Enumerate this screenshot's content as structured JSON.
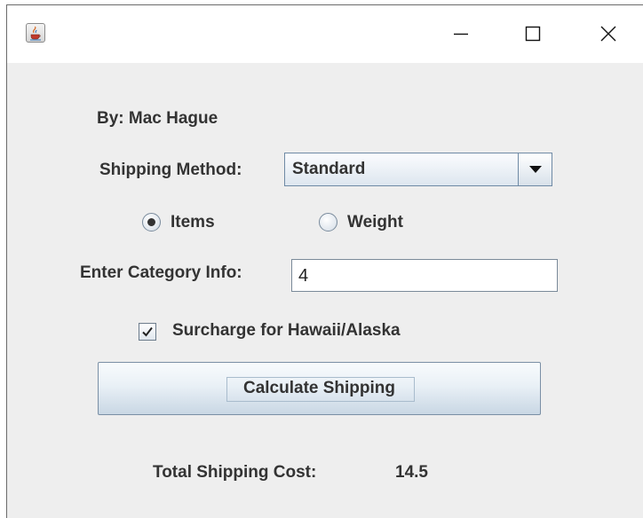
{
  "window": {
    "icon": "java-cup-icon",
    "controls": {
      "minimize_icon": "minimize-icon",
      "maximize_icon": "maximize-icon",
      "close_icon": "close-icon"
    }
  },
  "author_label": "By: Mac Hague",
  "shipping_method": {
    "label": "Shipping Method:",
    "selected": "Standard",
    "arrow_icon": "chevron-down-icon"
  },
  "category_type": {
    "options": [
      {
        "label": "Items",
        "selected": true
      },
      {
        "label": "Weight",
        "selected": false
      }
    ]
  },
  "category_info": {
    "label": "Enter Category Info:",
    "value": "4"
  },
  "surcharge": {
    "label": "Surcharge for Hawaii/Alaska",
    "checked": true
  },
  "calculate_button": {
    "label": "Calculate Shipping"
  },
  "result": {
    "label": "Total Shipping Cost:",
    "value": "14.5"
  },
  "colors": {
    "window_bg": "#eeeeee",
    "titlebar_bg": "#ffffff",
    "text": "#333333",
    "control_border": "#6f8aa5"
  }
}
